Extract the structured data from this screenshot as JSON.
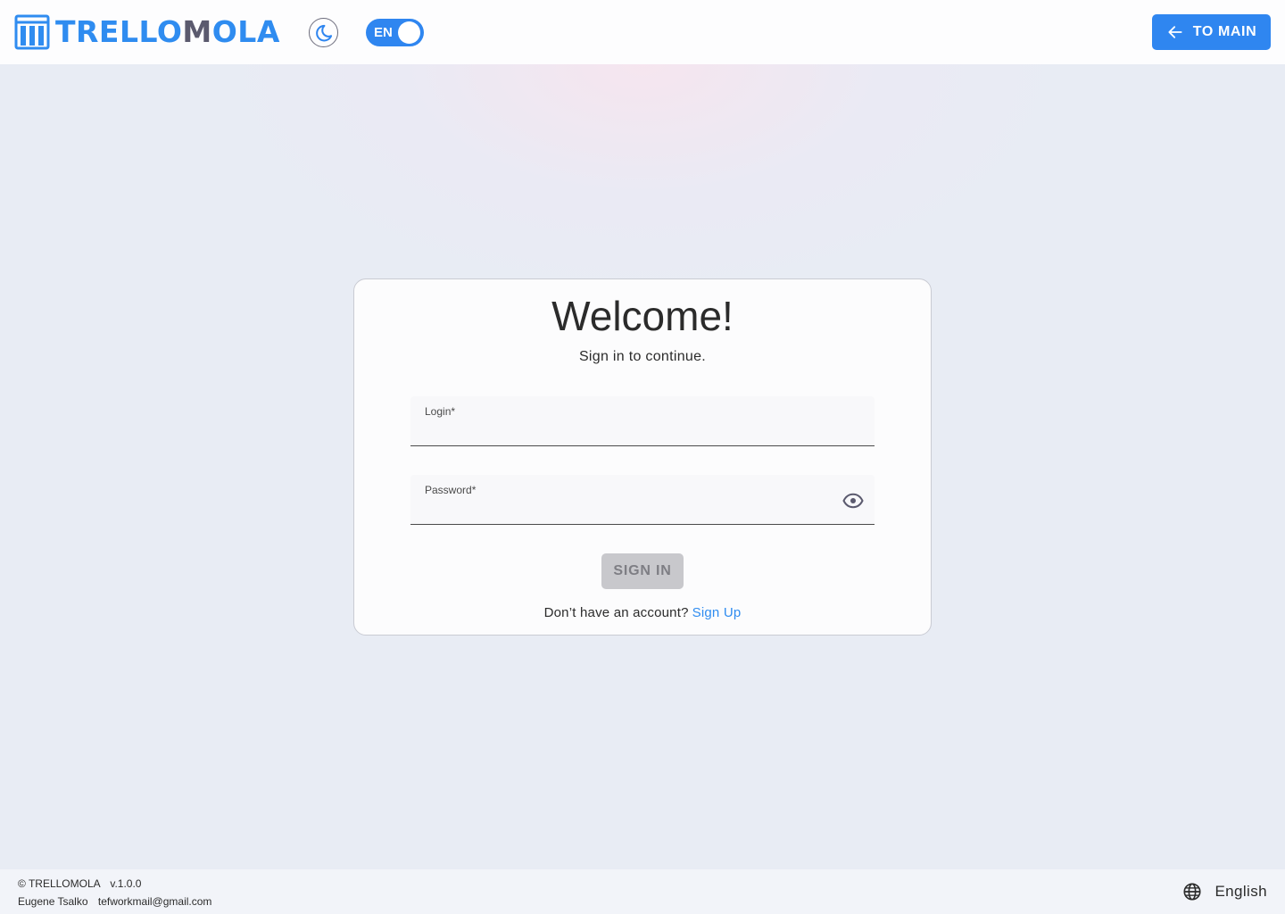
{
  "header": {
    "logo_part1": "TRELLO",
    "logo_part2": "M",
    "logo_part3": "OLA",
    "lang_toggle_label": "EN",
    "to_main_label": "TO MAIN"
  },
  "colors": {
    "accent": "#2f86f0",
    "logo_dark": "#5b5a6e",
    "disabled_button": "#c8c8cc",
    "background": "#e8ecf4"
  },
  "login_card": {
    "title": "Welcome!",
    "subtitle": "Sign in to continue.",
    "login_label": "Login*",
    "login_value": "",
    "password_label": "Password*",
    "password_value": "",
    "sign_in_label": "SIGN IN",
    "no_account_text": "Don’t have an account?",
    "sign_up_link": "Sign Up"
  },
  "footer": {
    "copyright": "© TRELLOMOLA",
    "version": "v.1.0.0",
    "author": "Eugene Tsalko",
    "email": "tefworkmail@gmail.com",
    "language": "English"
  },
  "icons": [
    "logo-board-icon",
    "moon-icon",
    "arrow-left-icon",
    "eye-icon",
    "globe-icon"
  ]
}
